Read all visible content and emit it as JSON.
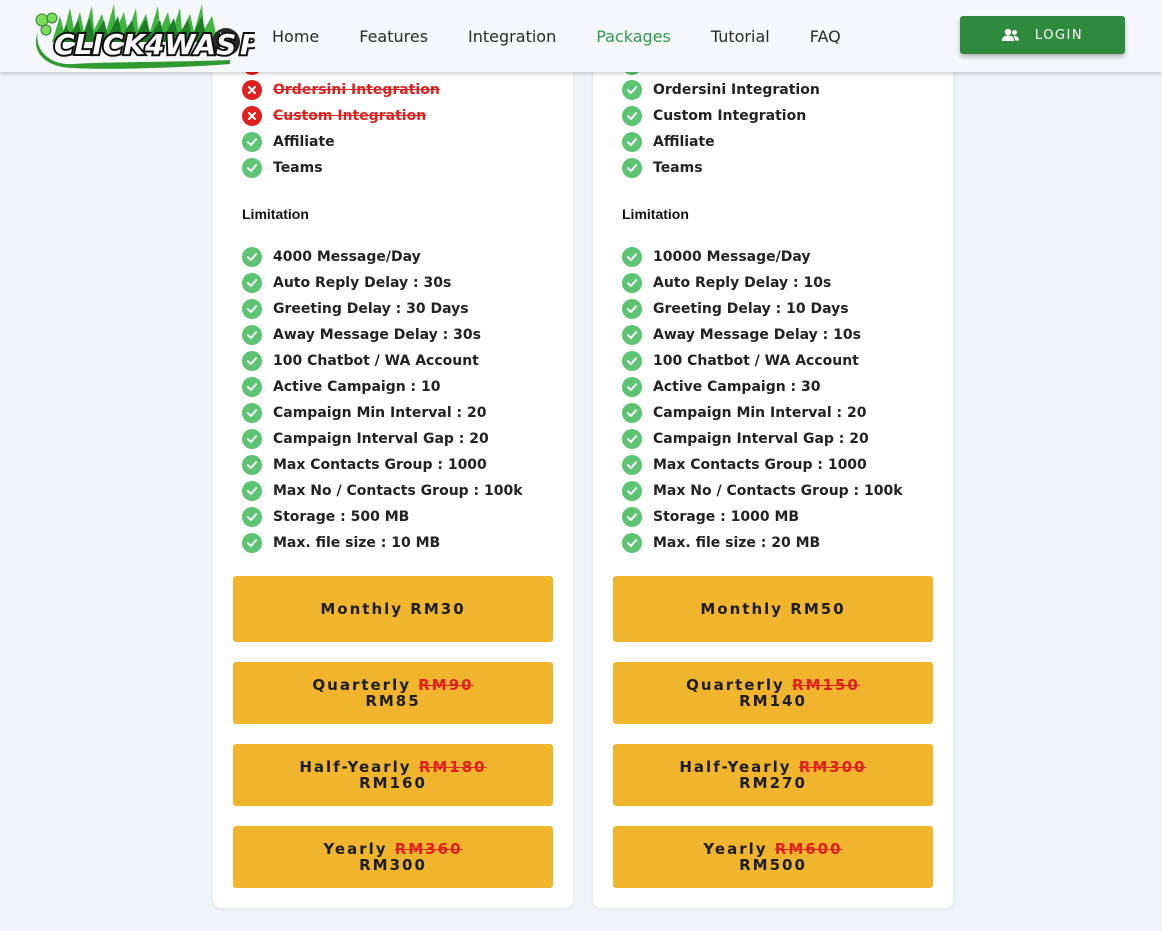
{
  "header": {
    "logo_text": "CLICK4WASAP",
    "nav": [
      "Home",
      "Features",
      "Integration",
      "Packages",
      "Tutorial",
      "FAQ"
    ],
    "active_nav": "Packages",
    "login_label": "LOGIN"
  },
  "colors": {
    "brand_green": "#2e8b3d",
    "nav_active": "#2f9a4b",
    "check_green": "#5cc473",
    "cross_red": "#e0201f",
    "price_yellow": "#f0b52c"
  },
  "icons": {
    "check": "check-circle-icon",
    "cross": "x-circle-icon",
    "login": "users-icon"
  },
  "plans": [
    {
      "features": [
        {
          "label": "Ordersini Integration",
          "available": false
        },
        {
          "label": "Custom Integration",
          "available": false
        },
        {
          "label": "Affiliate",
          "available": true
        },
        {
          "label": "Teams",
          "available": true
        }
      ],
      "limitation_title": "Limitation",
      "limits": [
        "4000 Message/Day",
        "Auto Reply Delay : 30s",
        "Greeting Delay : 30 Days",
        "Away Message Delay : 30s",
        "100 Chatbot / WA Account",
        "Active Campaign : 10",
        "Campaign Min Interval : 20",
        "Campaign Interval Gap : 20",
        "Max Contacts Group : 1000",
        "Max No / Contacts Group : 100k",
        "Storage : 500 MB",
        "Max. file size : 10 MB"
      ],
      "prices": [
        {
          "period": "Monthly",
          "old": "",
          "price": "RM30"
        },
        {
          "period": "Quarterly",
          "old": "RM90",
          "price": "RM85"
        },
        {
          "period": "Half-Yearly",
          "old": "RM180",
          "price": "RM160"
        },
        {
          "period": "Yearly",
          "old": "RM360",
          "price": "RM300"
        }
      ]
    },
    {
      "features": [
        {
          "label": "Ordersini Integration",
          "available": true
        },
        {
          "label": "Custom Integration",
          "available": true
        },
        {
          "label": "Affiliate",
          "available": true
        },
        {
          "label": "Teams",
          "available": true
        }
      ],
      "limitation_title": "Limitation",
      "limits": [
        "10000 Message/Day",
        "Auto Reply Delay : 10s",
        "Greeting Delay : 10 Days",
        "Away Message Delay : 10s",
        "100 Chatbot / WA Account",
        "Active Campaign : 30",
        "Campaign Min Interval : 20",
        "Campaign Interval Gap : 20",
        "Max Contacts Group : 1000",
        "Max No / Contacts Group : 100k",
        "Storage : 1000 MB",
        "Max. file size : 20 MB"
      ],
      "prices": [
        {
          "period": "Monthly",
          "old": "",
          "price": "RM50"
        },
        {
          "period": "Quarterly",
          "old": "RM150",
          "price": "RM140"
        },
        {
          "period": "Half-Yearly",
          "old": "RM300",
          "price": "RM270"
        },
        {
          "period": "Yearly",
          "old": "RM600",
          "price": "RM500"
        }
      ]
    }
  ]
}
